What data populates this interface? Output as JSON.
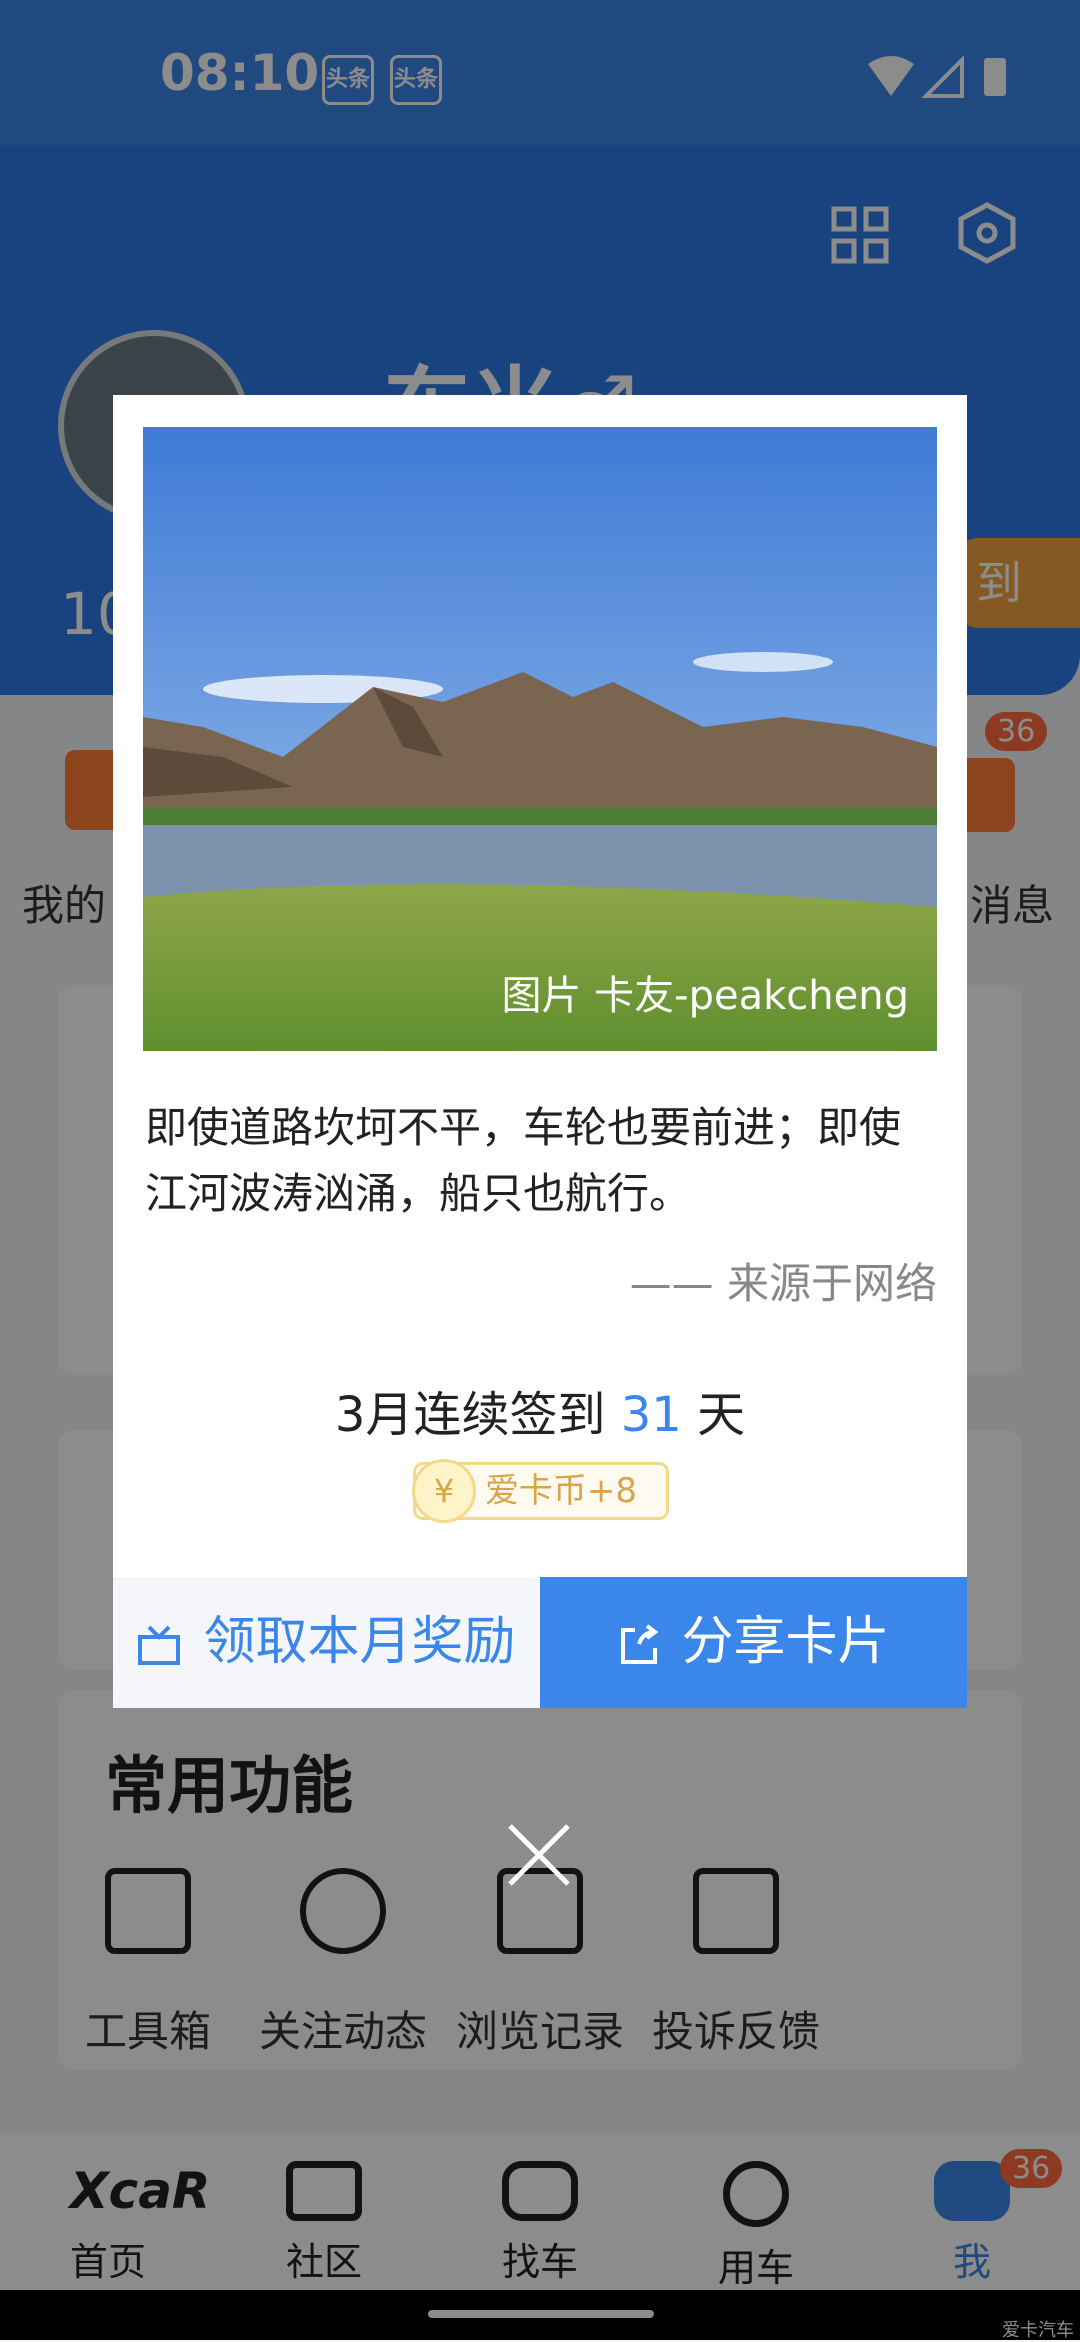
{
  "status_bar": {
    "time": "08:10",
    "news_icons": [
      "头条",
      "头条"
    ]
  },
  "profile": {
    "name": "一东米♂",
    "sign_label": "到",
    "count_partial": "10"
  },
  "quick_row": {
    "left_label": "我的",
    "right_label": "消息",
    "badge": "36"
  },
  "tools": {
    "title": "常用功能",
    "items": [
      {
        "label": "工具箱",
        "icon": "toolbox-icon"
      },
      {
        "label": "关注动态",
        "icon": "clock-icon"
      },
      {
        "label": "浏览记录",
        "icon": "document-icon"
      },
      {
        "label": "投诉反馈",
        "icon": "feedback-icon"
      }
    ]
  },
  "bottom_nav": {
    "items": [
      {
        "label": "首页",
        "icon": "xcar-logo-icon"
      },
      {
        "label": "社区",
        "icon": "chat-icon"
      },
      {
        "label": "找车",
        "icon": "car-icon"
      },
      {
        "label": "用车",
        "icon": "steering-wheel-icon"
      },
      {
        "label": "我",
        "icon": "me-icon"
      }
    ],
    "me_badge": "36"
  },
  "modal": {
    "photo_credit": "图片 卡友-peakcheng",
    "quote": "即使道路坎坷不平，车轮也要前进；即使江河波涛汹涌，船只也航行。",
    "source": "—— 来源于网络",
    "streak_prefix": "3月连续签到 ",
    "streak_days": "31",
    "streak_suffix": " 天",
    "coin_symbol": "¥",
    "coin_reward": "爱卡币+8",
    "left_button": "领取本月奖励",
    "right_button": "分享卡片"
  },
  "watermark": "爱卡汽车",
  "colors": {
    "primary": "#3b86ea",
    "accent": "#f4a340",
    "badge": "#ff6a3d"
  }
}
